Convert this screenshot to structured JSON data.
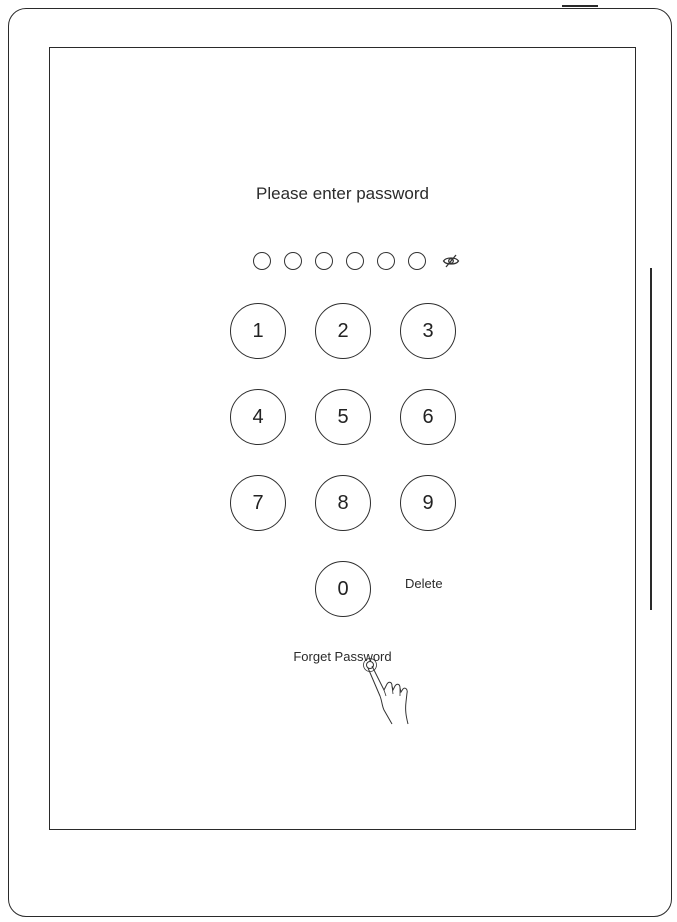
{
  "password_screen": {
    "title": "Please enter password",
    "pin_length": 6,
    "pin_entered": 0,
    "visibility_toggle_icon": "eye-slash-icon",
    "keys": [
      "1",
      "2",
      "3",
      "4",
      "5",
      "6",
      "7",
      "8",
      "9",
      "0"
    ],
    "delete_label": "Delete",
    "forget_password_label": "Forget Password",
    "pointer_icon": "hand-tap-icon"
  },
  "colors": {
    "background": "#ffffff",
    "stroke": "#2a2a2a",
    "text": "#222222"
  }
}
